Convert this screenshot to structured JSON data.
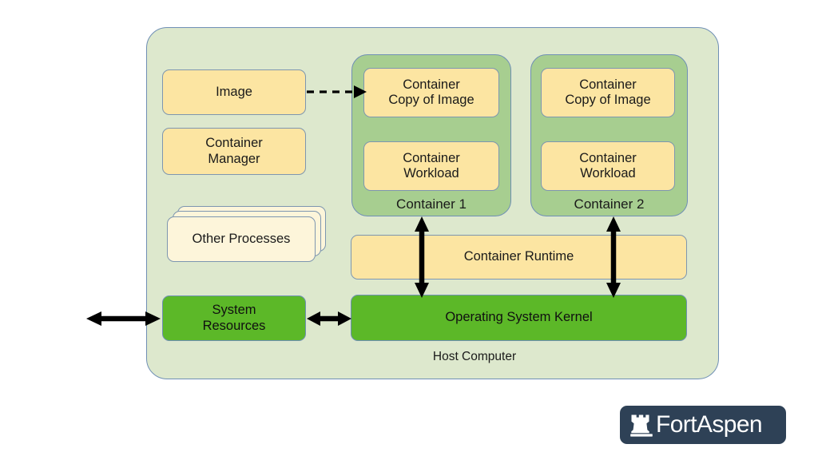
{
  "diagram": {
    "host": {
      "label": "Host Computer"
    },
    "left_column": {
      "image_box": "Image",
      "container_manager_box": "Container\nManager",
      "other_processes_box": "Other Processes",
      "system_resources_box": "System\nResources"
    },
    "containers": [
      {
        "caption": "Container 1",
        "copy_of_image": "Container\nCopy of Image",
        "workload": "Container\nWorkload"
      },
      {
        "caption": "Container 2",
        "copy_of_image": "Container\nCopy of Image",
        "workload": "Container\nWorkload"
      }
    ],
    "bars": {
      "container_runtime": "Container Runtime",
      "os_kernel": "Operating System Kernel"
    },
    "connectors": [
      {
        "name": "image-to-container1",
        "style": "dashed",
        "heads": "single"
      },
      {
        "name": "container1-to-kernel",
        "style": "solid",
        "heads": "double"
      },
      {
        "name": "container2-to-kernel",
        "style": "solid",
        "heads": "double"
      },
      {
        "name": "external-to-system-resources",
        "style": "solid",
        "heads": "double"
      },
      {
        "name": "system-resources-to-kernel",
        "style": "solid",
        "heads": "double"
      }
    ],
    "colors": {
      "host_panel": "#dde8cd",
      "container_panel": "#a7ce90",
      "yellow_box": "#fce5a2",
      "cream_card": "#fdf5da",
      "green_box": "#5cb828",
      "border": "#6f8fb5",
      "arrow": "#000000"
    }
  },
  "logo": {
    "text": "FortAspen",
    "icon": "chess-rook-icon",
    "background": "#2e4156",
    "foreground": "#ffffff"
  }
}
